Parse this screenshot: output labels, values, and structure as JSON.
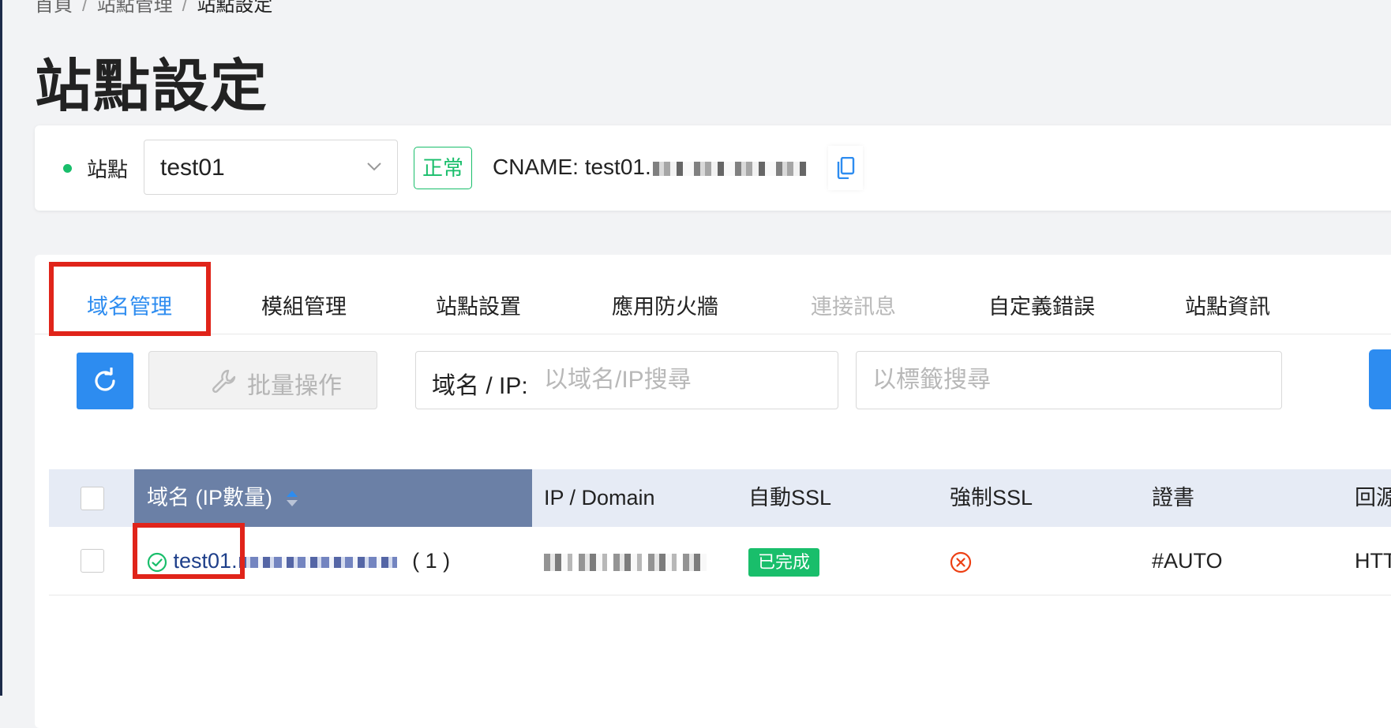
{
  "breadcrumb": {
    "items": [
      "首頁",
      "站點管理"
    ],
    "current": "站點設定"
  },
  "page_title": "站點設定",
  "site": {
    "label": "站點",
    "selected": "test01",
    "status": "正常",
    "cname_label": "CNAME:",
    "cname_value": "test01."
  },
  "tabs": [
    {
      "label": "域名管理",
      "state": "active"
    },
    {
      "label": "模組管理",
      "state": "normal"
    },
    {
      "label": "站點設置",
      "state": "normal"
    },
    {
      "label": "應用防火牆",
      "state": "normal"
    },
    {
      "label": "連接訊息",
      "state": "disabled"
    },
    {
      "label": "自定義錯誤",
      "state": "normal"
    },
    {
      "label": "站點資訊",
      "state": "normal"
    }
  ],
  "toolbar": {
    "batch_label": "批量操作",
    "search_prefix": "域名 / IP:",
    "search_placeholder": "以域名/IP搜尋",
    "tag_search_placeholder": "以標籤搜尋"
  },
  "table": {
    "columns": [
      "域名 (IP數量)",
      "IP / Domain",
      "自動SSL",
      "強制SSL",
      "證書",
      "回源"
    ],
    "rows": [
      {
        "domain": "test01.",
        "ip_count": "( 1 )",
        "auto_ssl": "已完成",
        "force_ssl": "disabled",
        "cert": "#AUTO",
        "origin": "HTT"
      }
    ]
  },
  "colors": {
    "primary": "#2d8cf0",
    "success": "#19be6b",
    "danger": "#ed4014",
    "annotation": "#e0241a",
    "sorted_header": "#6b80a6"
  }
}
